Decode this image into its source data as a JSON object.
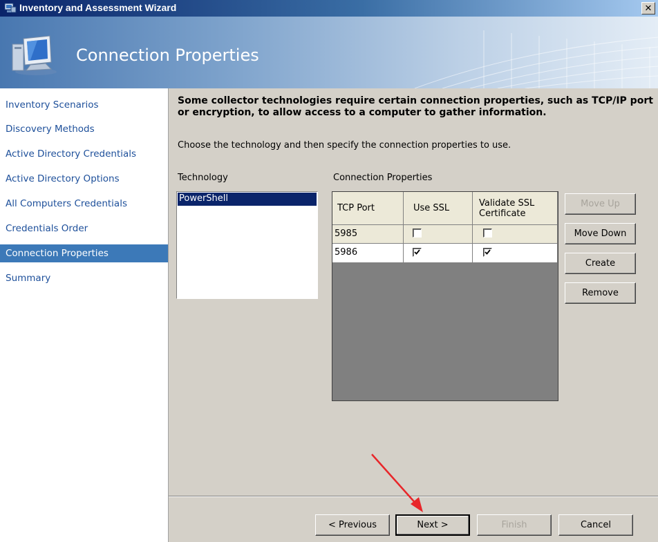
{
  "window": {
    "title": "Inventory and Assessment Wizard",
    "close_glyph": "✕"
  },
  "header": {
    "title": "Connection Properties",
    "icon": "computer-monitor-icon"
  },
  "sidebar": {
    "items": [
      {
        "label": "Inventory Scenarios"
      },
      {
        "label": "Discovery Methods"
      },
      {
        "label": "Active Directory Credentials"
      },
      {
        "label": "Active Directory Options"
      },
      {
        "label": "All Computers Credentials"
      },
      {
        "label": "Credentials Order"
      },
      {
        "label": "Connection Properties"
      },
      {
        "label": "Summary"
      }
    ],
    "active_index": 6
  },
  "main": {
    "intro_bold": "Some collector technologies require certain connection properties, such as TCP/IP port or encryption, to allow access to a computer to gather information.",
    "intro_text": "Choose the technology and then specify the connection properties to use.",
    "technology_label": "Technology",
    "technology_items": [
      "PowerShell"
    ],
    "connection_label": "Connection Properties",
    "grid": {
      "headers": [
        "TCP Port",
        "Use SSL",
        "Validate SSL",
        "Certificate"
      ],
      "rows": [
        {
          "port": "5985",
          "use_ssl": false,
          "validate_ssl": false
        },
        {
          "port": "5986",
          "use_ssl": true,
          "validate_ssl": true
        }
      ]
    },
    "side_buttons": {
      "move_up": "Move Up",
      "move_down": "Move Down",
      "create": "Create",
      "remove": "Remove"
    }
  },
  "footer": {
    "previous": "< Previous",
    "next": "Next >",
    "finish": "Finish",
    "cancel": "Cancel"
  },
  "colors": {
    "active_nav": "#3c79b8",
    "selection": "#0a246a",
    "annotation_arrow": "#e8262a"
  }
}
